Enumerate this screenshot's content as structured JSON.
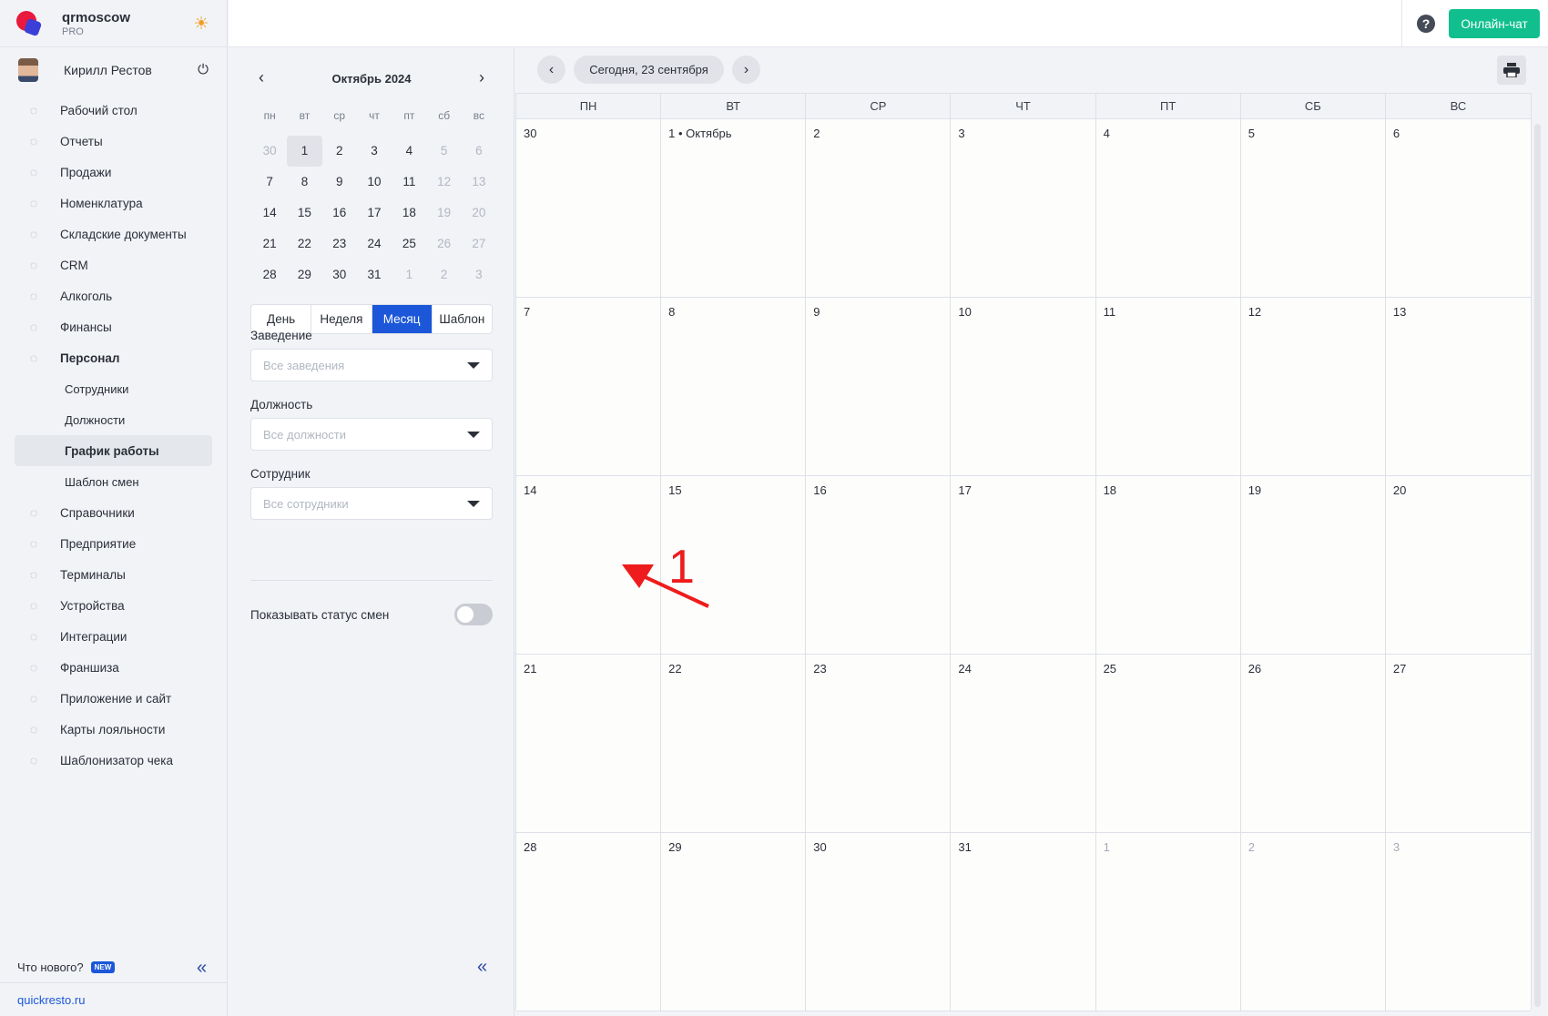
{
  "brand": {
    "name": "qrmoscow",
    "plan": "PRO"
  },
  "user": {
    "name": "Кирилл Рестов"
  },
  "nav": [
    {
      "label": "Рабочий стол",
      "icon": "dashboard-icon"
    },
    {
      "label": "Отчеты",
      "icon": "reports-icon"
    },
    {
      "label": "Продажи",
      "icon": "basket-icon"
    },
    {
      "label": "Номенклатура",
      "icon": "link-icon"
    },
    {
      "label": "Складские документы",
      "icon": "archive-icon"
    },
    {
      "label": "CRM",
      "icon": "crm-icon"
    },
    {
      "label": "Алкоголь",
      "icon": "glass-icon"
    },
    {
      "label": "Финансы",
      "icon": "wallet-icon"
    },
    {
      "label": "Персонал",
      "icon": "people-icon"
    },
    {
      "label": "Сотрудники"
    },
    {
      "label": "Должности"
    },
    {
      "label": "График работы"
    },
    {
      "label": "Шаблон смен"
    },
    {
      "label": "Справочники",
      "icon": "book-icon"
    },
    {
      "label": "Предприятие",
      "icon": "building-icon"
    },
    {
      "label": "Терминалы",
      "icon": "terminal-icon"
    },
    {
      "label": "Устройства",
      "icon": "printer-icon"
    },
    {
      "label": "Интеграции",
      "icon": "infinity-icon"
    },
    {
      "label": "Франшиза",
      "icon": "hierarchy-icon"
    },
    {
      "label": "Приложение и сайт",
      "icon": "monitor-icon"
    },
    {
      "label": "Карты лояльности",
      "icon": "card-icon"
    },
    {
      "label": "Шаблонизатор чека",
      "icon": "receipt-icon"
    }
  ],
  "footer": {
    "whats_new": "Что нового?",
    "new_badge": "NEW",
    "site": "quickresto.ru"
  },
  "header": {
    "chat_label": "Онлайн-чат",
    "help": "?"
  },
  "mini_calendar": {
    "month": "Октябрь 2024",
    "weekdays": [
      "пн",
      "вт",
      "ср",
      "чт",
      "пт",
      "сб",
      "вс"
    ],
    "days": [
      {
        "d": "30",
        "m": true
      },
      {
        "d": "1",
        "sel": true
      },
      {
        "d": "2"
      },
      {
        "d": "3"
      },
      {
        "d": "4"
      },
      {
        "d": "5",
        "m": true
      },
      {
        "d": "6",
        "m": true
      },
      {
        "d": "7"
      },
      {
        "d": "8"
      },
      {
        "d": "9"
      },
      {
        "d": "10"
      },
      {
        "d": "11"
      },
      {
        "d": "12",
        "m": true
      },
      {
        "d": "13",
        "m": true
      },
      {
        "d": "14"
      },
      {
        "d": "15"
      },
      {
        "d": "16"
      },
      {
        "d": "17"
      },
      {
        "d": "18"
      },
      {
        "d": "19",
        "m": true
      },
      {
        "d": "20",
        "m": true
      },
      {
        "d": "21"
      },
      {
        "d": "22"
      },
      {
        "d": "23"
      },
      {
        "d": "24"
      },
      {
        "d": "25"
      },
      {
        "d": "26",
        "m": true
      },
      {
        "d": "27",
        "m": true
      },
      {
        "d": "28"
      },
      {
        "d": "29"
      },
      {
        "d": "30"
      },
      {
        "d": "31"
      },
      {
        "d": "1",
        "m": true
      },
      {
        "d": "2",
        "m": true
      },
      {
        "d": "3",
        "m": true
      }
    ]
  },
  "views": {
    "day": "День",
    "week": "Неделя",
    "month": "Месяц",
    "template": "Шаблон",
    "active": "month"
  },
  "filters": {
    "venue_label": "Заведение",
    "venue_placeholder": "Все заведения",
    "position_label": "Должность",
    "position_placeholder": "Все должности",
    "employee_label": "Сотрудник",
    "employee_placeholder": "Все сотрудники",
    "show_status_label": "Показывать статус смен",
    "show_status": false
  },
  "calendar": {
    "today_label": "Сегодня, 23 сентября",
    "weekdays": [
      "ПН",
      "ВТ",
      "СР",
      "ЧТ",
      "ПТ",
      "СБ",
      "ВС"
    ],
    "cells": [
      {
        "d": "30"
      },
      {
        "d": "1 • Октябрь"
      },
      {
        "d": "2"
      },
      {
        "d": "3"
      },
      {
        "d": "4"
      },
      {
        "d": "5"
      },
      {
        "d": "6"
      },
      {
        "d": "7"
      },
      {
        "d": "8"
      },
      {
        "d": "9"
      },
      {
        "d": "10"
      },
      {
        "d": "11"
      },
      {
        "d": "12"
      },
      {
        "d": "13"
      },
      {
        "d": "14"
      },
      {
        "d": "15"
      },
      {
        "d": "16"
      },
      {
        "d": "17"
      },
      {
        "d": "18"
      },
      {
        "d": "19"
      },
      {
        "d": "20"
      },
      {
        "d": "21"
      },
      {
        "d": "22"
      },
      {
        "d": "23"
      },
      {
        "d": "24"
      },
      {
        "d": "25"
      },
      {
        "d": "26"
      },
      {
        "d": "27"
      },
      {
        "d": "28"
      },
      {
        "d": "29"
      },
      {
        "d": "30"
      },
      {
        "d": "31"
      },
      {
        "d": "1",
        "m": true
      },
      {
        "d": "2",
        "m": true
      },
      {
        "d": "3",
        "m": true
      }
    ]
  },
  "annotation": {
    "label": "1",
    "color": "#ee1c1c"
  },
  "colors": {
    "accent": "#1b57d8",
    "chat": "#11bf8e",
    "brand_red": "#e8193c"
  }
}
